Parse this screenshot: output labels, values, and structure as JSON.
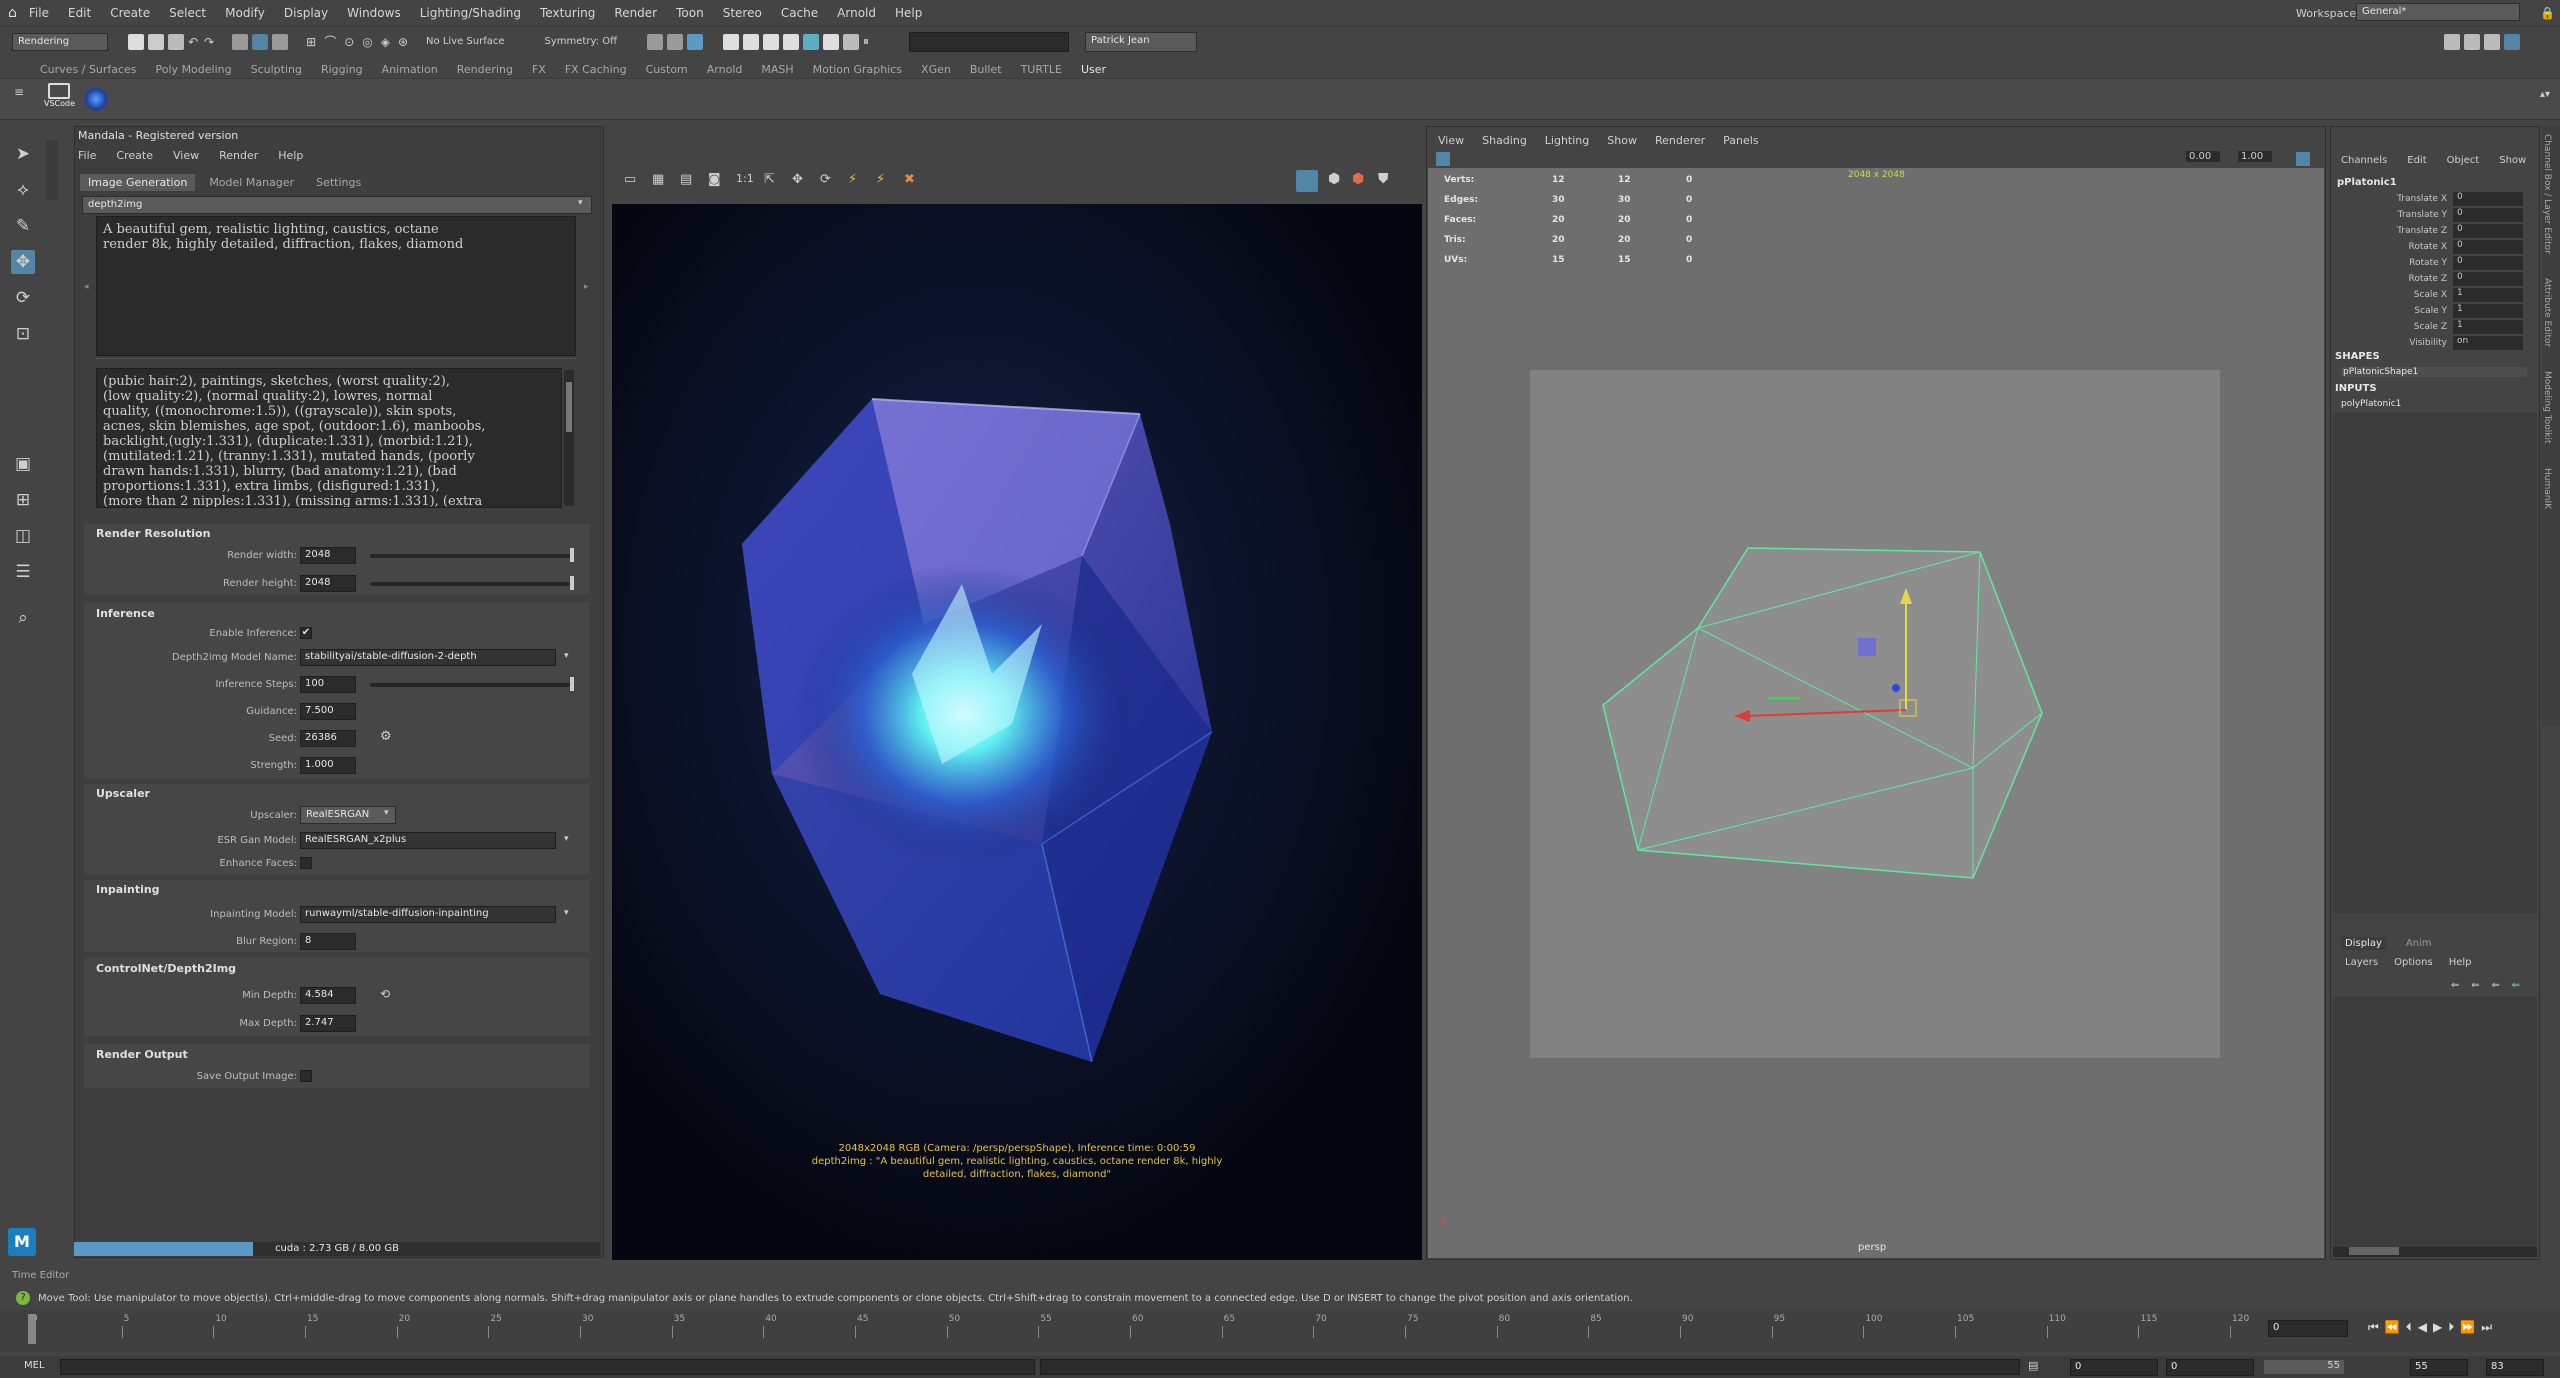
{
  "menubar": {
    "items": [
      "File",
      "Edit",
      "Create",
      "Select",
      "Modify",
      "Display",
      "Windows",
      "Lighting/Shading",
      "Texturing",
      "Render",
      "Toon",
      "Stereo",
      "Cache",
      "Arnold",
      "Help"
    ],
    "workspace_label": "Workspace:",
    "workspace_value": "General*"
  },
  "toolbar": {
    "mode": "Rendering",
    "symmetry": "Symmetry: Off",
    "live_surface": "No Live Surface",
    "user": "Patrick Jean"
  },
  "shelf": {
    "tabs": [
      "Curves / Surfaces",
      "Poly Modeling",
      "Sculpting",
      "Rigging",
      "Animation",
      "Rendering",
      "FX",
      "FX Caching",
      "Custom",
      "Arnold",
      "MASH",
      "Motion Graphics",
      "XGen",
      "Bullet",
      "TURTLE",
      "User"
    ],
    "active": "User",
    "vscode_label": "VSCode"
  },
  "plugin": {
    "title": "Mandala - Registered version",
    "menu": [
      "File",
      "Create",
      "View",
      "Render",
      "Help"
    ],
    "tabs": [
      "Image Generation",
      "Model Manager",
      "Settings"
    ],
    "mode": "depth2img",
    "prompt": "A beautiful gem, realistic lighting, caustics, octane\nrender 8k, highly detailed, diffraction, flakes, diamond",
    "negative_prompt": "(pubic hair:2), paintings, sketches, (worst quality:2),\n(low quality:2), (normal quality:2), lowres, normal\nquality, ((monochrome:1.5)), ((grayscale)), skin spots,\nacnes, skin blemishes, age spot, (outdoor:1.6), manboobs,\nbacklight,(ugly:1.331), (duplicate:1.331), (morbid:1.21),\n(mutilated:1.21), (tranny:1.331), mutated hands, (poorly\ndrawn hands:1.331), blurry, (bad anatomy:1.21), (bad\nproportions:1.331), extra limbs, (disfigured:1.331),\n(more than 2 nipples:1.331), (missing arms:1.331), (extra",
    "render_resolution": {
      "title": "Render Resolution",
      "width_label": "Render width:",
      "width": "2048",
      "height_label": "Render height:",
      "height": "2048"
    },
    "inference": {
      "title": "Inference",
      "enable_label": "Enable Inference:",
      "enable_checked": "✔",
      "model_label": "Depth2img Model Name:",
      "model": "stabilityai/stable-diffusion-2-depth",
      "steps_label": "Inference Steps:",
      "steps": "100",
      "guidance_label": "Guidance:",
      "guidance": "7.500",
      "seed_label": "Seed:",
      "seed": "26386",
      "strength_label": "Strength:",
      "strength": "1.000"
    },
    "upscaler": {
      "title": "Upscaler",
      "upscaler_label": "Upscaler:",
      "upscaler": "RealESRGAN",
      "esr_label": "ESR Gan Model:",
      "esr": "RealESRGAN_x2plus",
      "faces_label": "Enhance Faces:"
    },
    "inpainting": {
      "title": "Inpainting",
      "model_label": "Inpainting Model:",
      "model": "runwayml/stable-diffusion-inpainting",
      "blur_label": "Blur Region:",
      "blur": "8"
    },
    "controlnet": {
      "title": "ControlNet/Depth2Img",
      "min_label": "Min Depth:",
      "min": "4.584",
      "max_label": "Max Depth:",
      "max": "2.747"
    },
    "render_output": {
      "title": "Render Output",
      "save_label": "Save Output Image:"
    },
    "memory": "cuda : 2.73 GB / 8.00 GB",
    "memory_fraction": 0.34
  },
  "render": {
    "caption_line1": "2048x2048 RGB (Camera: /persp/perspShape), Inference time: 0:00:59",
    "caption_line2": "depth2img : \"A beautiful gem, realistic lighting, caustics, octane render 8k, highly",
    "caption_line3": "detailed, diffraction, flakes, diamond\""
  },
  "viewport": {
    "menu": [
      "View",
      "Shading",
      "Lighting",
      "Show",
      "Renderer",
      "Panels"
    ],
    "resolution_gate": "2048 x 2048",
    "stats": [
      {
        "label": "Verts:",
        "a": "12",
        "b": "12",
        "c": "0"
      },
      {
        "label": "Edges:",
        "a": "30",
        "b": "30",
        "c": "0"
      },
      {
        "label": "Faces:",
        "a": "20",
        "b": "20",
        "c": "0"
      },
      {
        "label": "Tris:",
        "a": "20",
        "b": "20",
        "c": "0"
      },
      {
        "label": "UVs:",
        "a": "15",
        "b": "15",
        "c": "0"
      }
    ],
    "camera_name": "persp",
    "near": "0.00",
    "far": "1.00"
  },
  "channels": {
    "tabs": [
      "Channels",
      "Edit",
      "Object",
      "Show"
    ],
    "object": "pPlatonic1",
    "attrs": [
      {
        "label": "Translate X",
        "value": "0"
      },
      {
        "label": "Translate Y",
        "value": "0"
      },
      {
        "label": "Translate Z",
        "value": "0"
      },
      {
        "label": "Rotate X",
        "value": "0"
      },
      {
        "label": "Rotate Y",
        "value": "0"
      },
      {
        "label": "Rotate Z",
        "value": "0"
      },
      {
        "label": "Scale X",
        "value": "1"
      },
      {
        "label": "Scale Y",
        "value": "1"
      },
      {
        "label": "Scale Z",
        "value": "1"
      },
      {
        "label": "Visibility",
        "value": "on"
      }
    ],
    "shapes_title": "SHAPES",
    "shape": "pPlatonicShape1",
    "inputs_title": "INPUTS",
    "input": "polyPlatonic1",
    "layer_tabs": [
      "Display",
      "Anim"
    ],
    "layer_menu": [
      "Layers",
      "Options",
      "Help"
    ],
    "side_tabs": [
      "Channel Box / Layer Editor",
      "Attribute Editor",
      "Modeling Toolkit",
      "HumanIK"
    ]
  },
  "time_editor_label": "Time Editor",
  "help_line": "Move Tool: Use manipulator to move object(s). Ctrl+middle-drag to move components along normals. Shift+drag manipulator axis or plane handles to extrude components or clone objects. Ctrl+Shift+drag to constrain movement to a connected edge. Use D or INSERT to change the pivot position and axis orientation.",
  "timeline": {
    "ticks": [
      "0",
      "5",
      "10",
      "15",
      "20",
      "25",
      "30",
      "35",
      "40",
      "45",
      "50",
      "55",
      "60",
      "65",
      "70",
      "75",
      "80",
      "85",
      "90",
      "95",
      "100",
      "105",
      "110",
      "115",
      "120"
    ],
    "current": "0",
    "range_start": "0",
    "range_start2": "0",
    "range_end": "55",
    "range_end2": "55",
    "end": "83"
  },
  "cmd": {
    "label": "MEL"
  }
}
